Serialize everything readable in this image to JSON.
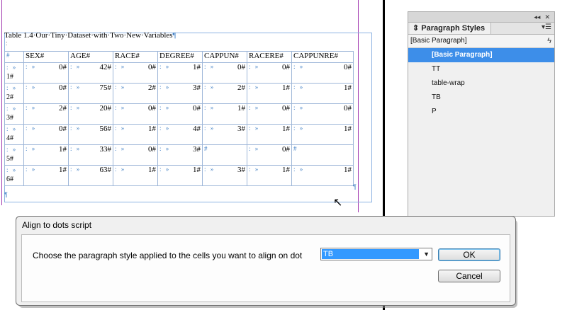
{
  "document": {
    "caption": "Table 1.4·Our·Tiny·Dataset·with·Two·New·Variables",
    "caption_mark": "¶",
    "table": {
      "headers": [
        "#",
        "SEX#",
        "AGE#",
        "RACE#",
        "DEGREE#",
        "CAPPUN#",
        "RACERE#",
        "CAPPUNRE#"
      ],
      "rows": [
        {
          "id": "1#",
          "cells": [
            "0#",
            "42#",
            "0#",
            "1#",
            "0#",
            "0#",
            "0#"
          ]
        },
        {
          "id": "2#",
          "cells": [
            "0#",
            "75#",
            "2#",
            "3#",
            "2#",
            "1#",
            "1#"
          ]
        },
        {
          "id": "3#",
          "cells": [
            "2#",
            "20#",
            "0#",
            "0#",
            "1#",
            "0#",
            "0#"
          ]
        },
        {
          "id": "4#",
          "cells": [
            "0#",
            "56#",
            "1#",
            "4#",
            "3#",
            "1#",
            "1#"
          ]
        },
        {
          "id": "5#",
          "cells": [
            "1#",
            "33#",
            "0#",
            "3#",
            "#",
            "0#",
            "#"
          ]
        },
        {
          "id": "6#",
          "cells": [
            "1#",
            "63#",
            "1#",
            "1#",
            "3#",
            "1#",
            "1#"
          ]
        }
      ]
    }
  },
  "panel": {
    "title": "Paragraph Styles",
    "current_style": "[Basic Paragraph]",
    "styles": [
      "[Basic Paragraph]",
      "TT",
      "table-wrap",
      "TB",
      "P"
    ],
    "selected_index": 0
  },
  "dialog": {
    "title": "Align to dots script",
    "prompt": "Choose the paragraph style applied to the cells you want to align on dot",
    "selected_value": "TB",
    "ok_label": "OK",
    "cancel_label": "Cancel"
  },
  "colors": {
    "accent_selection": "#3d8ee9",
    "frame_border": "#8db3e2",
    "margin_guide": "#a23ab0"
  }
}
